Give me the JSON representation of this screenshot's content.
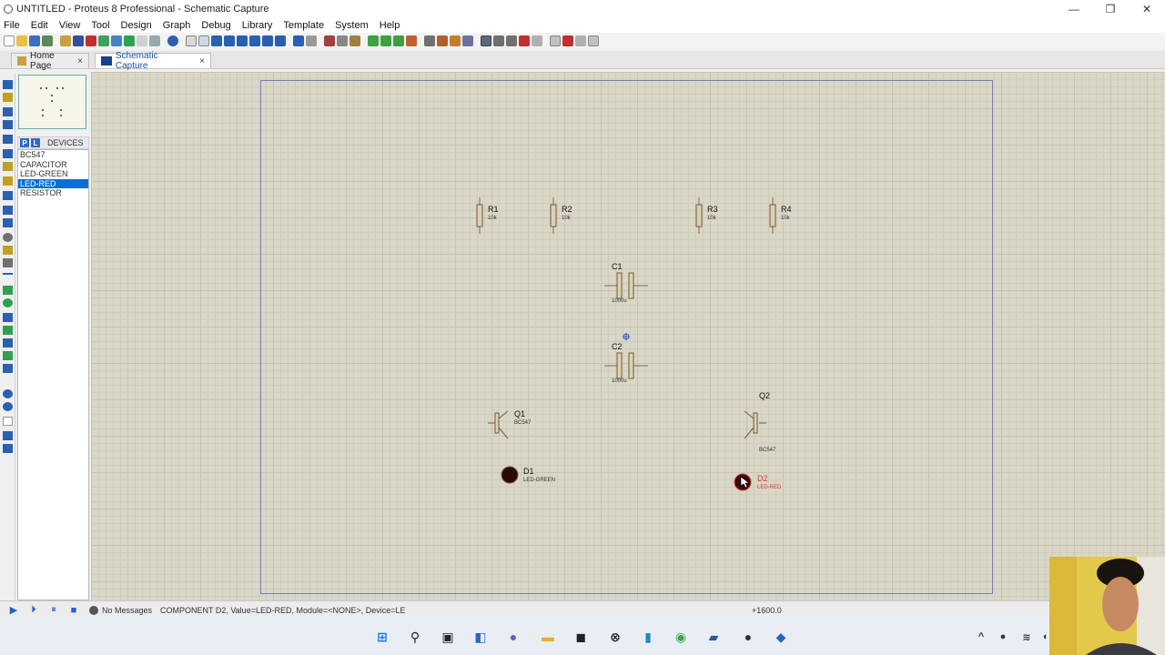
{
  "window": {
    "title": "UNTITLED - Proteus 8 Professional - Schematic Capture",
    "controls": [
      "—",
      "❐",
      "✕"
    ]
  },
  "menu": [
    "File",
    "Edit",
    "View",
    "Tool",
    "Design",
    "Graph",
    "Debug",
    "Library",
    "Template",
    "System",
    "Help"
  ],
  "tabs": [
    {
      "label": "Home Page",
      "close": "×"
    },
    {
      "label": "Schematic Capture",
      "close": "×"
    }
  ],
  "devices": {
    "mode_p": "P",
    "mode_l": "L",
    "header": "DEVICES",
    "items": [
      "BC547",
      "CAPACITOR",
      "LED-GREEN",
      "LED-RED",
      "RESISTOR"
    ],
    "selected": "LED-RED"
  },
  "components": {
    "r1": {
      "ref": "R1",
      "value": "10k"
    },
    "r2": {
      "ref": "R2",
      "value": "10k"
    },
    "r3": {
      "ref": "R3",
      "value": "10k"
    },
    "r4": {
      "ref": "R4",
      "value": "10k"
    },
    "c1": {
      "ref": "C1",
      "value": "1000u"
    },
    "c2": {
      "ref": "C2",
      "value": "1000u"
    },
    "q1": {
      "ref": "Q1",
      "value": "BC547"
    },
    "q2": {
      "ref": "Q2",
      "value": "BC547"
    },
    "d1": {
      "ref": "D1",
      "value": "LED-GREEN"
    },
    "d2": {
      "ref": "D2",
      "value": "LED-RED"
    }
  },
  "status": {
    "messages": "No Messages",
    "info": "COMPONENT D2, Value=LED-RED, Module=<NONE>, Device=LE",
    "coord": "+1600.0"
  },
  "colors": {
    "selected_label": "#d83a3a",
    "sheet_border": "#7b7bb5",
    "canvas": "#d9d7c7"
  }
}
